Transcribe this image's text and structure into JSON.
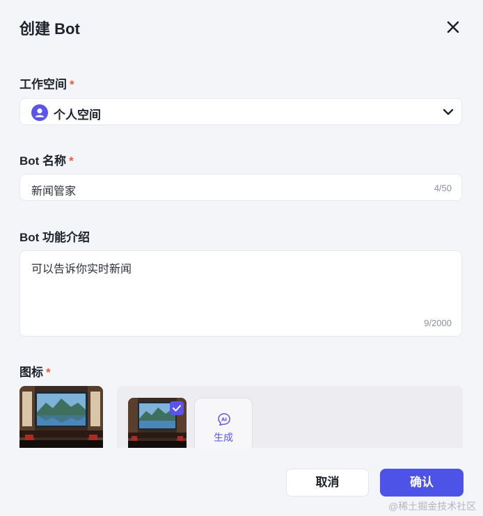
{
  "dialog": {
    "title": "创建 Bot",
    "close_icon": "close-icon"
  },
  "workspace": {
    "label": "工作空间",
    "required_mark": "*",
    "value": "个人空间",
    "icon": "user-avatar-icon",
    "dropdown_icon": "chevron-down-icon"
  },
  "bot_name": {
    "label": "Bot 名称",
    "required_mark": "*",
    "value": "新闻管家",
    "counter": "4/50"
  },
  "bot_description": {
    "label": "Bot 功能介绍",
    "value": "可以告诉你实时新闻",
    "counter": "9/2000"
  },
  "icon_section": {
    "label": "图标",
    "required_mark": "*",
    "selected_icon": "landscape-tv-room-image",
    "generate_label": "生成",
    "generate_icon": "ai-chat-icon"
  },
  "footer": {
    "cancel_label": "取消",
    "confirm_label": "确认"
  },
  "watermark": "@稀土掘金技术社区",
  "colors": {
    "accent": "#4d53e6",
    "required": "#f05b3b",
    "background": "#f4f5f9"
  }
}
